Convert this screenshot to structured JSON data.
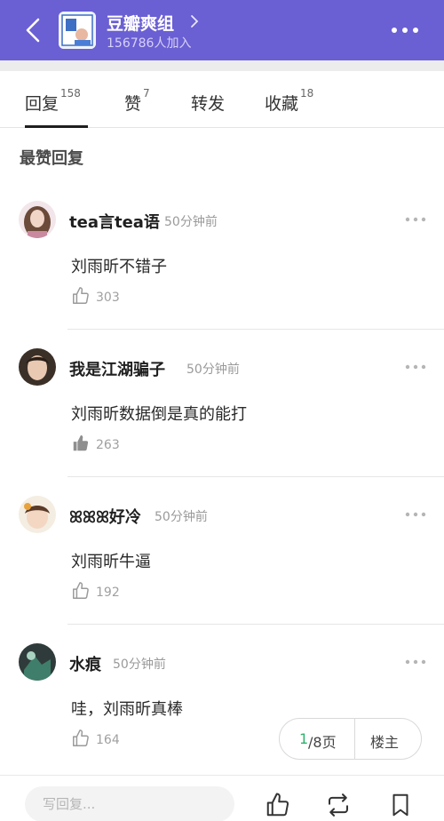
{
  "header": {
    "group_name": "豆瓣爽组",
    "members": "156786人加入",
    "brand_color": "#6a5fd3"
  },
  "tabs": [
    {
      "label": "回复",
      "count": "158"
    },
    {
      "label": "赞",
      "count": "7"
    },
    {
      "label": "转发",
      "count": ""
    },
    {
      "label": "收藏",
      "count": "18"
    }
  ],
  "section_title": "最赞回复",
  "replies": [
    {
      "user": "tea言tea语",
      "time": "50分钟前",
      "content": "刘雨昕不错子",
      "likes": "303",
      "liked": false
    },
    {
      "user": "我是江湖骗子",
      "time": "50分钟前",
      "content": "刘雨昕数据倒是真的能打",
      "likes": "263",
      "liked": true
    },
    {
      "user": "ꕤꕤꕤ好冷",
      "time": "50分钟前",
      "content": "刘雨昕牛逼",
      "likes": "192",
      "liked": false
    },
    {
      "user": "水痕",
      "time": "50分钟前",
      "content": "哇，刘雨昕真棒",
      "likes": "164",
      "liked": false
    }
  ],
  "pager": {
    "current": "1",
    "total": "/8页",
    "op_label": "楼主"
  },
  "bottom": {
    "placeholder": "写回复..."
  },
  "icons": [
    "back-icon",
    "chevron-right-icon",
    "more-icon",
    "thumbs-up-icon",
    "repost-icon",
    "bookmark-icon"
  ]
}
